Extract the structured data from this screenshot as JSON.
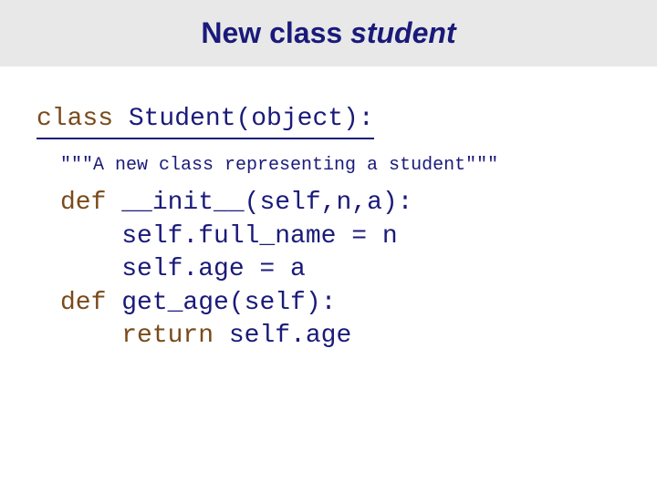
{
  "title": {
    "prefix": "New class ",
    "italic": "student"
  },
  "code": {
    "class_kw": "class",
    "class_rest": " Student(object):",
    "docstring": "\"\"\"A new class representing a student\"\"\"",
    "def1_kw": "def",
    "def1_rest": " __init__(self,n,a):",
    "line2": "    self.full_name = n",
    "line3": "    self.age = a",
    "def2_kw": "def",
    "def2_rest": " get_age(self):",
    "ret_kw": "    return",
    "ret_rest": " self.age"
  }
}
